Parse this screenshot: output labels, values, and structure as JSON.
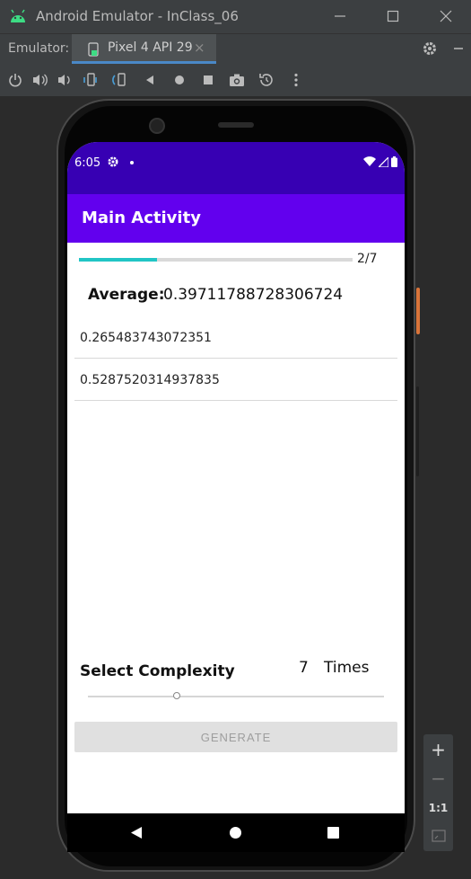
{
  "window": {
    "title": "Android Emulator - InClass_06",
    "minimize_icon": "minimize-icon",
    "maximize_icon": "maximize-icon",
    "close_icon": "close-icon"
  },
  "tabbar": {
    "label": "Emulator:",
    "tab_label": "Pixel 4 API 29",
    "tab_close": "×"
  },
  "toolbar": {
    "icons": [
      "power-icon",
      "volume-up-icon",
      "volume-down-icon",
      "rotate-left-icon",
      "rotate-right-icon",
      "back-icon",
      "home-icon",
      "overview-icon",
      "camera-icon",
      "snapshot-icon",
      "more-icon"
    ]
  },
  "device": {
    "status": {
      "time": "6:05"
    },
    "appbar_title": "Main Activity",
    "progress": {
      "text": "2/7",
      "fraction": 0.2857
    },
    "average": {
      "label": "Average:",
      "value": "0.39711788728306724"
    },
    "numbers": [
      "0.265483743072351",
      "0.5287520314937835"
    ],
    "complexity": {
      "label": "Select Complexity",
      "count": "7",
      "unit": "Times",
      "slider_fraction": 0.3
    },
    "generate_label": "GENERATE"
  },
  "zoom": {
    "plus": "+",
    "minus": "−",
    "ratio": "1:1"
  },
  "colors": {
    "statusbar": "#3700b3",
    "appbar": "#6200ee",
    "progress": "#21c5c5"
  }
}
